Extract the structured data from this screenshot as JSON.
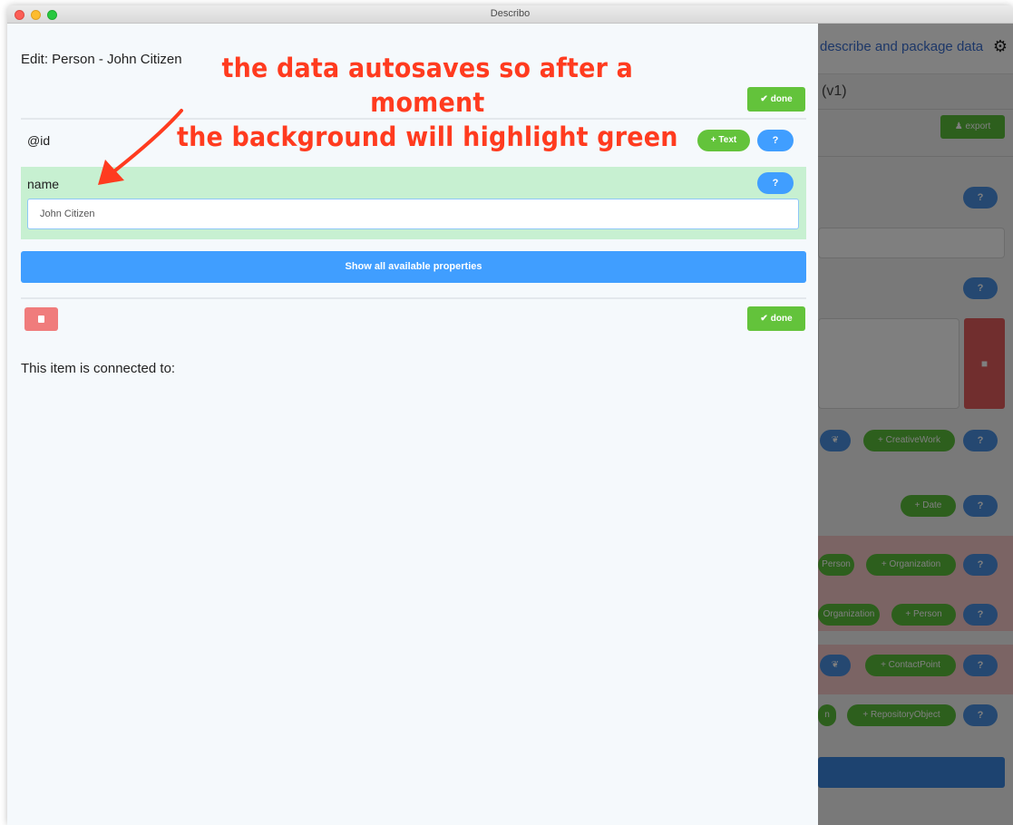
{
  "window": {
    "title": "Describo"
  },
  "background_app": {
    "tagline": "describe and package data",
    "version_fragment": "(v1)",
    "export_label": "export",
    "help_label": "?",
    "trash_icon": "trash-icon",
    "buttons": {
      "creative_work": "+ CreativeWork",
      "date": "+ Date",
      "person_partial": "Person",
      "organization": "+ Organization",
      "organization_partial": "Organization",
      "person": "+ Person",
      "contact_point": "+ ContactPoint",
      "repository_object_partial": "n",
      "repository_object": "+ RepositoryObject"
    }
  },
  "panel": {
    "title": "Edit: Person - John Citizen",
    "done_label": "done",
    "id_label": "@id",
    "text_button": "+ Text",
    "help_label": "?",
    "name_label": "name",
    "name_value": "John Citizen",
    "show_all_label": "Show all available properties",
    "connected_label": "This item is connected to:"
  },
  "annotation": {
    "line1": "the data autosaves so after a moment",
    "line2": "the background will highlight green"
  },
  "colors": {
    "done_green": "#63c33b",
    "help_blue": "#409eff",
    "highlight_green": "#c7f0d1",
    "delete_red": "#f07c7c",
    "annotation_red": "#ff3b1f"
  }
}
